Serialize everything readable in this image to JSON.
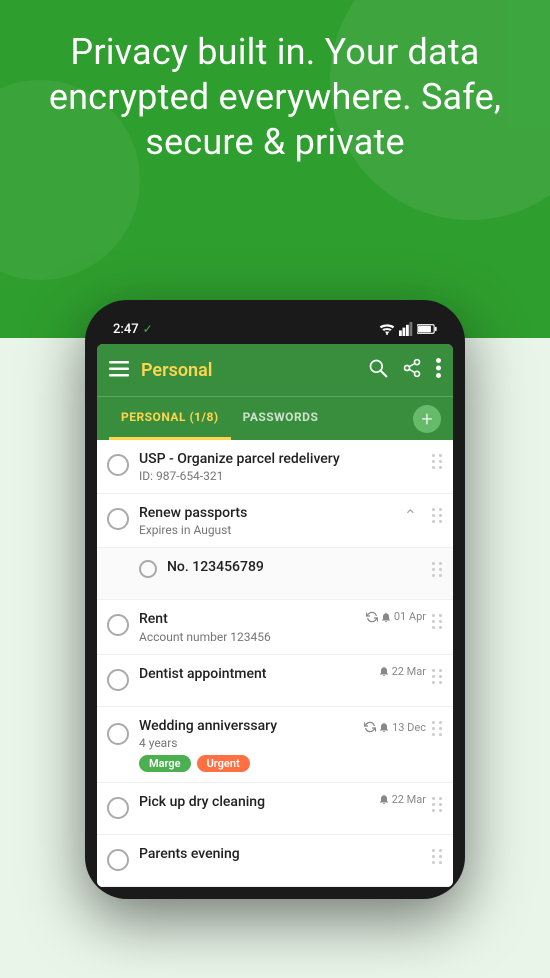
{
  "hero": {
    "text": "Privacy built in. Your data encrypted everywhere. Safe, secure & private"
  },
  "phone": {
    "time": "2:47",
    "tick": "✓"
  },
  "toolbar": {
    "title": "Personal",
    "menu_label": "☰",
    "search_label": "🔍",
    "share_label": "⮀",
    "more_label": "⋮"
  },
  "tabs": [
    {
      "label": "PERSONAL (1/8)",
      "active": true
    },
    {
      "label": "PASSWORDS",
      "active": false
    }
  ],
  "add_button_label": "+",
  "tasks": [
    {
      "title": "USP - Organize parcel redelivery",
      "sub": "ID: 987-654-321",
      "date": null,
      "expanded": false,
      "tags": []
    },
    {
      "title": "Renew passports",
      "sub": "Expires in August",
      "date": null,
      "expanded": true,
      "tags": []
    },
    {
      "title": "No. 123456789",
      "sub": null,
      "date": null,
      "indented": true,
      "tags": []
    },
    {
      "title": "Rent",
      "sub": "Account number 123456",
      "date": "01 Apr",
      "has_repeat": true,
      "has_bell": true,
      "tags": []
    },
    {
      "title": "Dentist appointment",
      "sub": null,
      "date": "22 Mar",
      "has_repeat": false,
      "has_bell": true,
      "tags": []
    },
    {
      "title": "Wedding anniverssary",
      "sub": "4 years",
      "date": "13 Dec",
      "has_repeat": true,
      "has_bell": true,
      "tags": [
        "Marge",
        "Urgent"
      ]
    },
    {
      "title": "Pick up dry cleaning",
      "sub": null,
      "date": "22 Mar",
      "has_repeat": false,
      "has_bell": true,
      "tags": []
    },
    {
      "title": "Parents evening",
      "sub": null,
      "date": null,
      "tags": []
    }
  ]
}
